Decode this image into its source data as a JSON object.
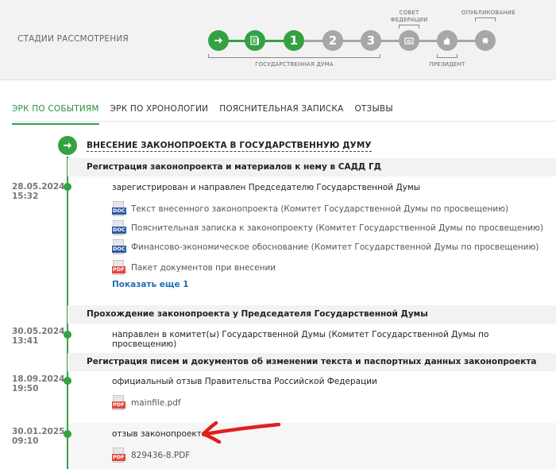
{
  "stages": {
    "title": "СТАДИИ РАССМОТРЕНИЯ",
    "steps": [
      {
        "label": "",
        "state": "done",
        "icon": "arrow-right-icon"
      },
      {
        "label": "",
        "state": "done",
        "icon": "document-list-icon"
      },
      {
        "label": "1",
        "state": "current",
        "icon": ""
      },
      {
        "label": "2",
        "state": "pending",
        "icon": ""
      },
      {
        "label": "3",
        "state": "pending",
        "icon": ""
      },
      {
        "label": "",
        "state": "pending",
        "icon": "federation-council-icon"
      },
      {
        "label": "",
        "state": "pending",
        "icon": "president-icon"
      },
      {
        "label": "",
        "state": "pending",
        "icon": "eagle-emblem-icon"
      }
    ],
    "gosduma_label": "ГОСУДАРСТВЕННАЯ ДУМА",
    "sovet_label_1": "СОВЕТ",
    "sovet_label_2": "ФЕДЕРАЦИИ",
    "president_label": "ПРЕЗИДЕНТ",
    "publication_label": "ОПУБЛИКОВАНИЕ",
    "accent_color": "#34a143"
  },
  "tabs": [
    {
      "label": "ЭРК ПО СОБЫТИЯМ",
      "active": true
    },
    {
      "label": "ЭРК ПО ХРОНОЛОГИИ",
      "active": false
    },
    {
      "label": "ПОЯСНИТЕЛЬНАЯ ЗАПИСКА",
      "active": false
    },
    {
      "label": "ОТЗЫВЫ",
      "active": false
    }
  ],
  "timeline": {
    "stage_title": "ВНЕСЕНИЕ ЗАКОНОПРОЕКТА В ГОСУДАРСТВЕННУЮ ДУМУ",
    "sections": [
      {
        "title": "Регистрация законопроекта и материалов к нему в САДД ГД",
        "date": "28.05.2024",
        "time": "15:32",
        "event": "зарегистрирован и направлен Председателю Государственной Думы",
        "docs": [
          {
            "type": "DOC",
            "name": "Текст внесенного законопроекта (Комитет Государственной Думы по просвещению)"
          },
          {
            "type": "DOC",
            "name": "Пояснительная записка к законопроекту (Комитет Государственной Думы по просвещению)"
          },
          {
            "type": "DOC",
            "name": "Финансово-экономическое обоснование (Комитет Государственной Думы по просвещению)"
          },
          {
            "type": "PDF",
            "name": "Пакет документов при внесении"
          }
        ],
        "show_more": "Показать еще 1"
      },
      {
        "title": "Прохождение законопроекта у Председателя Государственной Думы",
        "date": "30.05.2024",
        "time": "13:41",
        "event": "направлен в комитет(ы) Государственной Думы (Комитет Государственной Думы по просвещению)"
      },
      {
        "title": "Регистрация писем и документов об изменении текста и паспортных данных законопроекта",
        "events": [
          {
            "date": "18.09.2024",
            "time": "19:50",
            "event": "официальный отзыв Правительства Российской Федерации",
            "docs": [
              {
                "type": "PDF",
                "name": "mainfile.pdf"
              }
            ]
          },
          {
            "date": "30.01.2025",
            "time": "09:10",
            "event": "отзыв законопроекта",
            "docs": [
              {
                "type": "PDF",
                "name": "829436-8.PDF"
              }
            ]
          }
        ]
      }
    ]
  },
  "annotation_color": "#e0201e"
}
